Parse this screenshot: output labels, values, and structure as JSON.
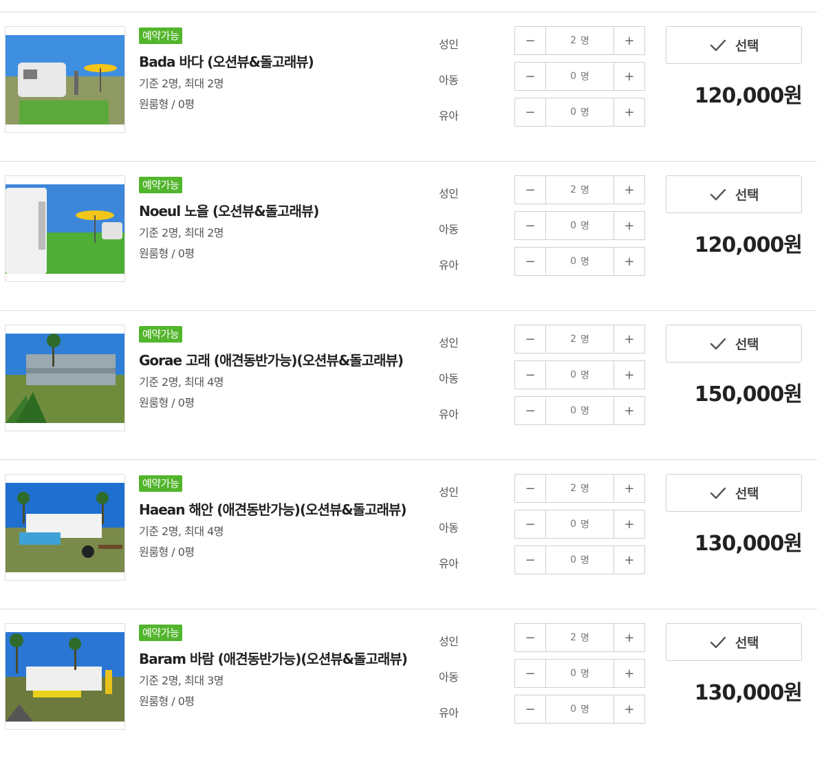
{
  "rooms": [
    {
      "badge": "예약가능",
      "name": "Bada 바다 (오션뷰&돌고래뷰)",
      "capacity": "기준 2명, 최대 2명",
      "type": "원룸형 / 0평",
      "select_label": "선택",
      "price": "120,000원",
      "guests": [
        {
          "label": "성인",
          "value": "2",
          "unit": "명"
        },
        {
          "label": "아동",
          "value": "0",
          "unit": "명"
        },
        {
          "label": "유아",
          "value": "0",
          "unit": "명"
        }
      ]
    },
    {
      "badge": "예약가능",
      "name": "Noeul 노을 (오션뷰&돌고래뷰)",
      "capacity": "기준 2명, 최대 2명",
      "type": "원룸형 / 0평",
      "select_label": "선택",
      "price": "120,000원",
      "guests": [
        {
          "label": "성인",
          "value": "2",
          "unit": "명"
        },
        {
          "label": "아동",
          "value": "0",
          "unit": "명"
        },
        {
          "label": "유아",
          "value": "0",
          "unit": "명"
        }
      ]
    },
    {
      "badge": "예약가능",
      "name": "Gorae 고래 (애견동반가능)(오션뷰&돌고래뷰)",
      "capacity": "기준 2명, 최대 4명",
      "type": "원룸형 / 0평",
      "select_label": "선택",
      "price": "150,000원",
      "guests": [
        {
          "label": "성인",
          "value": "2",
          "unit": "명"
        },
        {
          "label": "아동",
          "value": "0",
          "unit": "명"
        },
        {
          "label": "유아",
          "value": "0",
          "unit": "명"
        }
      ]
    },
    {
      "badge": "예약가능",
      "name": "Haean 해안 (애견동반가능)(오션뷰&돌고래뷰)",
      "capacity": "기준 2명, 최대 4명",
      "type": "원룸형 / 0평",
      "select_label": "선택",
      "price": "130,000원",
      "guests": [
        {
          "label": "성인",
          "value": "2",
          "unit": "명"
        },
        {
          "label": "아동",
          "value": "0",
          "unit": "명"
        },
        {
          "label": "유아",
          "value": "0",
          "unit": "명"
        }
      ]
    },
    {
      "badge": "예약가능",
      "name": "Baram 바람 (애견동반가능)(오션뷰&돌고래뷰)",
      "capacity": "기준 2명, 최대 3명",
      "type": "원룸형 / 0평",
      "select_label": "선택",
      "price": "130,000원",
      "guests": [
        {
          "label": "성인",
          "value": "2",
          "unit": "명"
        },
        {
          "label": "아동",
          "value": "0",
          "unit": "명"
        },
        {
          "label": "유아",
          "value": "0",
          "unit": "명"
        }
      ]
    }
  ],
  "icons": {
    "minus": "−",
    "plus": "+",
    "check": "check-icon"
  },
  "colors": {
    "badge": "#52b52c",
    "border": "#cfcfcf",
    "divider": "#dcdcdc"
  }
}
